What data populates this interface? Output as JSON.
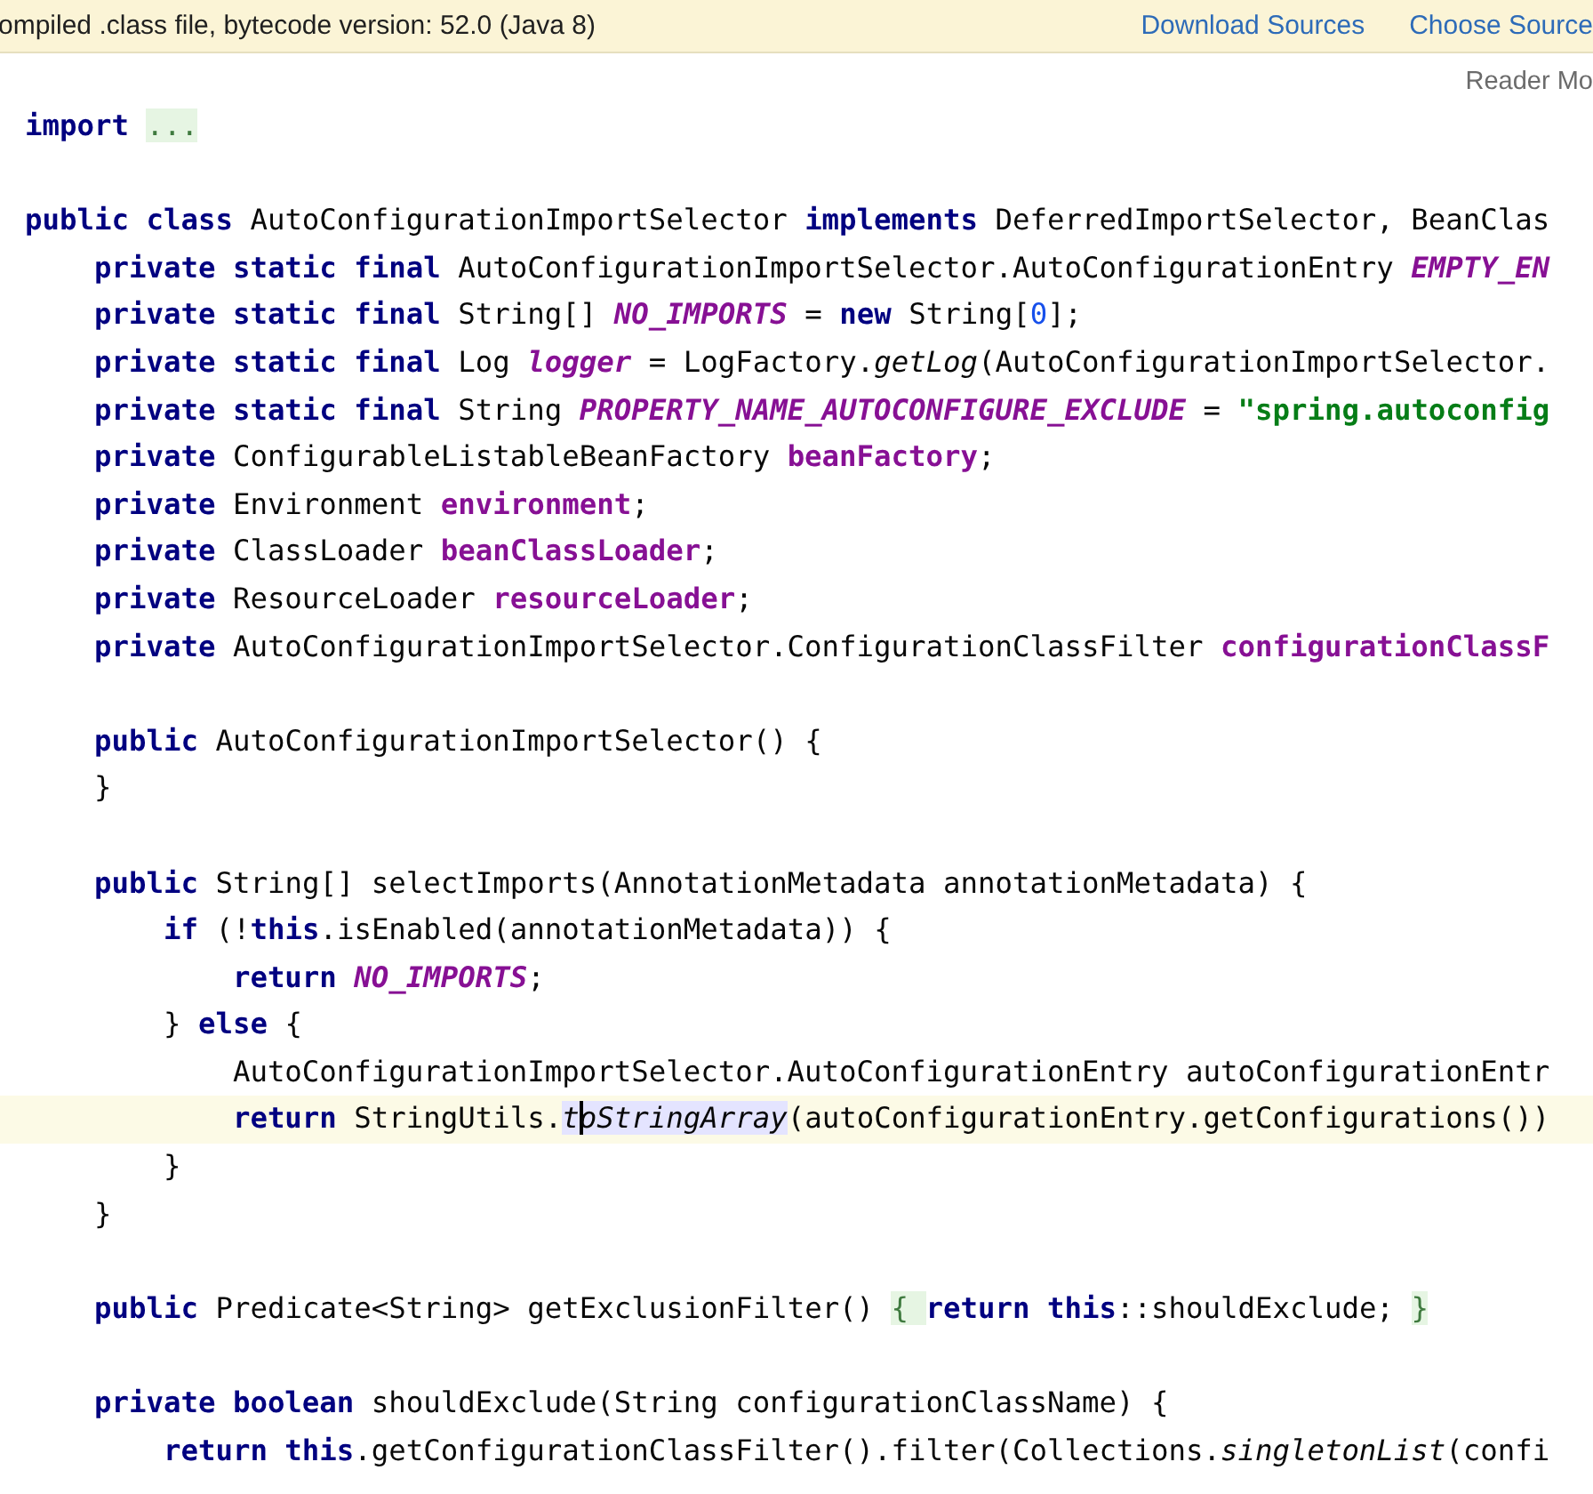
{
  "banner": {
    "message": "ompiled .class file, bytecode version: 52.0 (Java 8)",
    "links": [
      "Download Sources",
      "Choose Source"
    ]
  },
  "reader_mode": "Reader Mo",
  "code": {
    "blocks": [
      {
        "lines": [
          {
            "current": false,
            "tokens": [
              {
                "kind": "keyword",
                "text": "import "
              },
              {
                "kind": "fold",
                "text": "..."
              }
            ]
          }
        ]
      },
      {
        "lines": [
          {
            "current": false,
            "tokens": [
              {
                "kind": "keyword",
                "text": "public class"
              },
              {
                "kind": "plain",
                "text": " AutoConfigurationImportSelector "
              },
              {
                "kind": "keyword",
                "text": "implements"
              },
              {
                "kind": "plain",
                "text": " DeferredImportSelector, BeanClas"
              }
            ]
          },
          {
            "current": false,
            "tokens": [
              {
                "kind": "keyword",
                "text": "    private static final"
              },
              {
                "kind": "plain",
                "text": " AutoConfigurationImportSelector.AutoConfigurationEntry "
              },
              {
                "kind": "constant",
                "text": "EMPTY_EN"
              }
            ]
          },
          {
            "current": false,
            "tokens": [
              {
                "kind": "keyword",
                "text": "    private static final"
              },
              {
                "kind": "plain",
                "text": " String[] "
              },
              {
                "kind": "constant",
                "text": "NO_IMPORTS"
              },
              {
                "kind": "plain",
                "text": " = "
              },
              {
                "kind": "keyword",
                "text": "new"
              },
              {
                "kind": "plain",
                "text": " String["
              },
              {
                "kind": "number",
                "text": "0"
              },
              {
                "kind": "plain",
                "text": "];"
              }
            ]
          },
          {
            "current": false,
            "tokens": [
              {
                "kind": "keyword",
                "text": "    private static final"
              },
              {
                "kind": "plain",
                "text": " Log "
              },
              {
                "kind": "constant",
                "text": "logger"
              },
              {
                "kind": "plain",
                "text": " = LogFactory."
              },
              {
                "kind": "static-call",
                "text": "getLog"
              },
              {
                "kind": "plain",
                "text": "(AutoConfigurationImportSelector."
              }
            ]
          },
          {
            "current": false,
            "tokens": [
              {
                "kind": "keyword",
                "text": "    private static final"
              },
              {
                "kind": "plain",
                "text": " String "
              },
              {
                "kind": "constant",
                "text": "PROPERTY_NAME_AUTOCONFIGURE_EXCLUDE"
              },
              {
                "kind": "plain",
                "text": " = "
              },
              {
                "kind": "string",
                "text": "\"spring.autoconfig"
              }
            ]
          },
          {
            "current": false,
            "tokens": [
              {
                "kind": "keyword",
                "text": "    private"
              },
              {
                "kind": "plain",
                "text": " ConfigurableListableBeanFactory "
              },
              {
                "kind": "field",
                "text": "beanFactory"
              },
              {
                "kind": "plain",
                "text": ";"
              }
            ]
          },
          {
            "current": false,
            "tokens": [
              {
                "kind": "keyword",
                "text": "    private"
              },
              {
                "kind": "plain",
                "text": " Environment "
              },
              {
                "kind": "field",
                "text": "environment"
              },
              {
                "kind": "plain",
                "text": ";"
              }
            ]
          },
          {
            "current": false,
            "tokens": [
              {
                "kind": "keyword",
                "text": "    private"
              },
              {
                "kind": "plain",
                "text": " ClassLoader "
              },
              {
                "kind": "field",
                "text": "beanClassLoader"
              },
              {
                "kind": "plain",
                "text": ";"
              }
            ]
          },
          {
            "current": false,
            "tokens": [
              {
                "kind": "keyword",
                "text": "    private"
              },
              {
                "kind": "plain",
                "text": " ResourceLoader "
              },
              {
                "kind": "field",
                "text": "resourceLoader"
              },
              {
                "kind": "plain",
                "text": ";"
              }
            ]
          },
          {
            "current": false,
            "tokens": [
              {
                "kind": "keyword",
                "text": "    private"
              },
              {
                "kind": "plain",
                "text": " AutoConfigurationImportSelector.ConfigurationClassFilter "
              },
              {
                "kind": "field",
                "text": "configurationClassF"
              }
            ]
          }
        ]
      },
      {
        "lines": [
          {
            "current": false,
            "tokens": [
              {
                "kind": "keyword",
                "text": "    public"
              },
              {
                "kind": "plain",
                "text": " AutoConfigurationImportSelector() {"
              }
            ]
          },
          {
            "current": false,
            "tokens": [
              {
                "kind": "plain",
                "text": "    }"
              }
            ]
          }
        ]
      },
      {
        "lines": [
          {
            "current": false,
            "tokens": [
              {
                "kind": "keyword",
                "text": "    public"
              },
              {
                "kind": "plain",
                "text": " String[] selectImports(AnnotationMetadata annotationMetadata) {"
              }
            ]
          },
          {
            "current": false,
            "tokens": [
              {
                "kind": "keyword",
                "text": "        if"
              },
              {
                "kind": "plain",
                "text": " (!"
              },
              {
                "kind": "keyword",
                "text": "this"
              },
              {
                "kind": "plain",
                "text": ".isEnabled(annotationMetadata)) {"
              }
            ]
          },
          {
            "current": false,
            "tokens": [
              {
                "kind": "keyword",
                "text": "            return "
              },
              {
                "kind": "constant",
                "text": "NO_IMPORTS"
              },
              {
                "kind": "plain",
                "text": ";"
              }
            ]
          },
          {
            "current": false,
            "tokens": [
              {
                "kind": "plain",
                "text": "        } "
              },
              {
                "kind": "keyword",
                "text": "else"
              },
              {
                "kind": "plain",
                "text": " {"
              }
            ]
          },
          {
            "current": false,
            "tokens": [
              {
                "kind": "plain",
                "text": "            AutoConfigurationImportSelector.AutoConfigurationEntry autoConfigurationEntr"
              }
            ]
          },
          {
            "current": true,
            "tokens": [
              {
                "kind": "keyword",
                "text": "            return"
              },
              {
                "kind": "plain",
                "text": " StringUtils."
              },
              {
                "kind": "static-call",
                "text": "t",
                "highlight": true
              },
              {
                "kind": "static-call",
                "text": "oStringArray",
                "highlight": true,
                "caret": true
              },
              {
                "kind": "plain",
                "text": "(autoConfigurationEntry.getConfigurations())"
              }
            ]
          },
          {
            "current": false,
            "tokens": [
              {
                "kind": "plain",
                "text": "        }"
              }
            ]
          },
          {
            "current": false,
            "tokens": [
              {
                "kind": "plain",
                "text": "    }"
              }
            ]
          }
        ]
      },
      {
        "lines": [
          {
            "current": false,
            "tokens": [
              {
                "kind": "keyword",
                "text": "    public"
              },
              {
                "kind": "plain",
                "text": " Predicate<String> getExclusionFilter() "
              },
              {
                "kind": "fold",
                "text": "{ "
              },
              {
                "kind": "keyword",
                "text": "return this"
              },
              {
                "kind": "plain",
                "text": "::shouldExclude; "
              },
              {
                "kind": "fold",
                "text": "}"
              }
            ]
          }
        ]
      },
      {
        "lines": [
          {
            "current": false,
            "tokens": [
              {
                "kind": "keyword",
                "text": "    private boolean"
              },
              {
                "kind": "plain",
                "text": " shouldExclude(String configurationClassName) {"
              }
            ]
          },
          {
            "current": false,
            "tokens": [
              {
                "kind": "keyword",
                "text": "        return this"
              },
              {
                "kind": "plain",
                "text": ".getConfigurationClassFilter().filter(Collections."
              },
              {
                "kind": "static-call",
                "text": "singletonList"
              },
              {
                "kind": "plain",
                "text": "(confi"
              }
            ]
          }
        ]
      }
    ]
  }
}
